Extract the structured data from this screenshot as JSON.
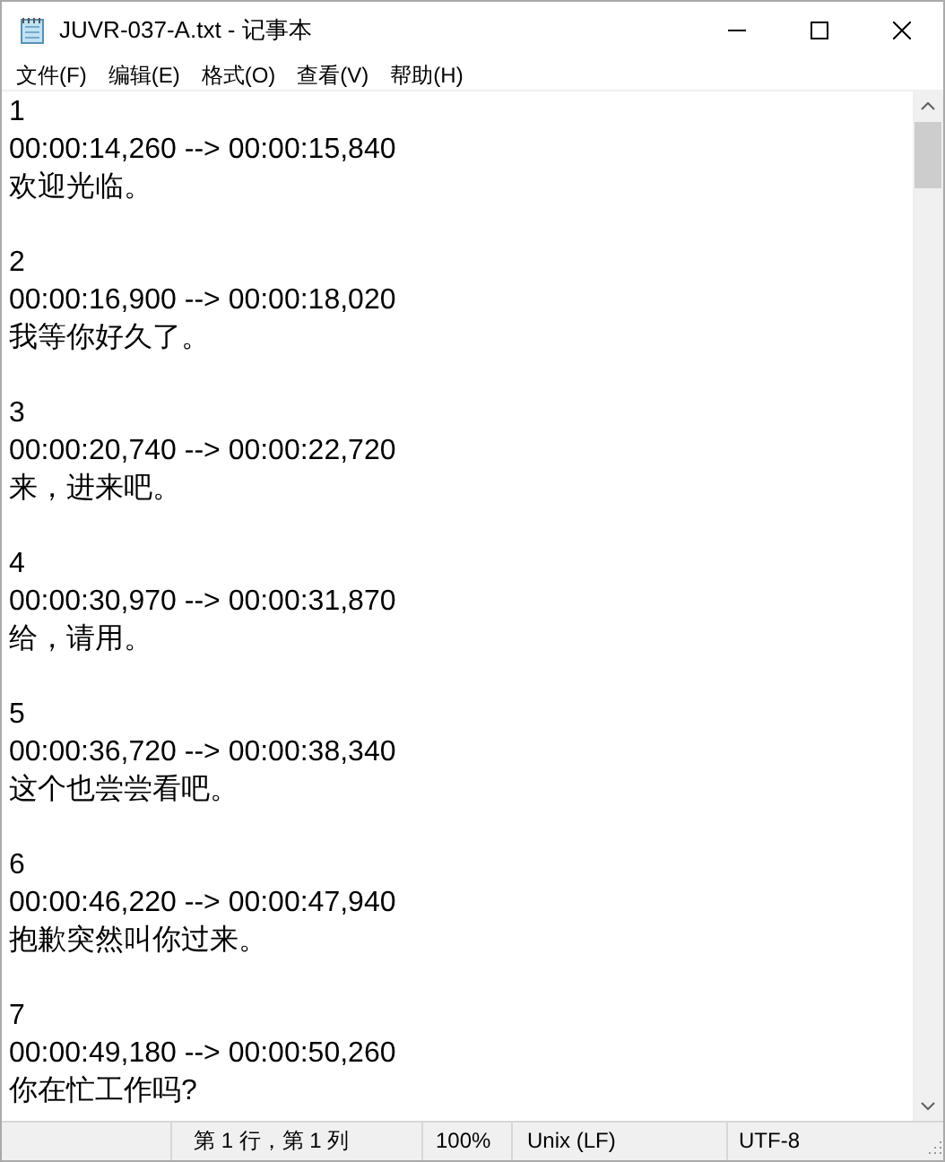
{
  "window": {
    "title": "JUVR-037-A.txt - 记事本"
  },
  "menu": [
    "文件(F)",
    "编辑(E)",
    "格式(O)",
    "查看(V)",
    "帮助(H)"
  ],
  "subtitles": [
    {
      "number": "1",
      "timing": "00:00:14,260 --> 00:00:15,840",
      "text": "欢迎光临。"
    },
    {
      "number": "2",
      "timing": "00:00:16,900 --> 00:00:18,020",
      "text": "我等你好久了。"
    },
    {
      "number": "3",
      "timing": "00:00:20,740 --> 00:00:22,720",
      "text": "来，进来吧。"
    },
    {
      "number": "4",
      "timing": "00:00:30,970 --> 00:00:31,870",
      "text": "给，请用。"
    },
    {
      "number": "5",
      "timing": "00:00:36,720 --> 00:00:38,340",
      "text": "这个也尝尝看吧。"
    },
    {
      "number": "6",
      "timing": "00:00:46,220 --> 00:00:47,940",
      "text": "抱歉突然叫你过来。"
    },
    {
      "number": "7",
      "timing": "00:00:49,180 --> 00:00:50,260",
      "text": "你在忙工作吗?"
    }
  ],
  "status_bar": {
    "position": "第 1 行，第 1 列",
    "zoom": "100%",
    "line_ending": "Unix (LF)",
    "encoding": "UTF-8"
  }
}
